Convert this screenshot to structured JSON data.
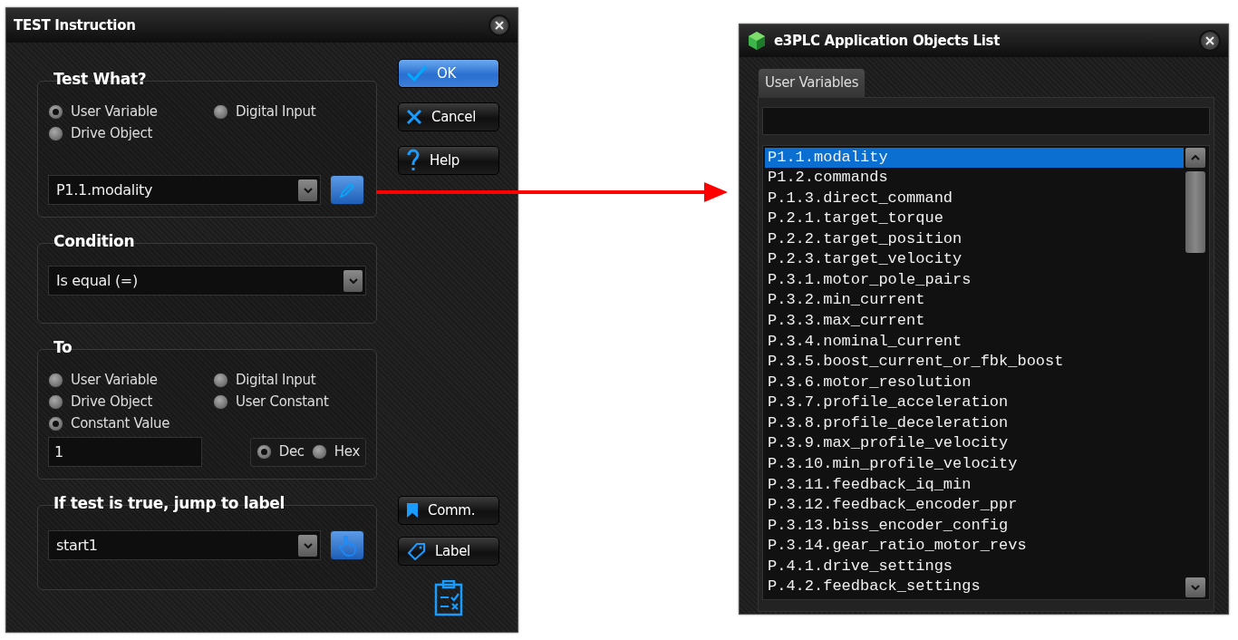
{
  "test_dialog": {
    "title": "TEST Instruction",
    "test_what": {
      "heading": "Test What?",
      "options": [
        {
          "label": "User Variable",
          "selected": true
        },
        {
          "label": "Digital Input",
          "selected": false
        },
        {
          "label": "Drive Object",
          "selected": false
        }
      ],
      "value": "P1.1.modality"
    },
    "condition": {
      "heading": "Condition",
      "value": "Is equal (=)"
    },
    "to": {
      "heading": "To",
      "options": [
        {
          "label": "User Variable",
          "selected": false
        },
        {
          "label": "Digital Input",
          "selected": false
        },
        {
          "label": "Drive Object",
          "selected": false
        },
        {
          "label": "User Constant",
          "selected": false
        },
        {
          "label": "Constant Value",
          "selected": true
        }
      ],
      "value": "1",
      "base": [
        {
          "label": "Dec",
          "selected": true
        },
        {
          "label": "Hex",
          "selected": false
        }
      ]
    },
    "jump": {
      "heading": "If test is true, jump to label",
      "value": "start1"
    },
    "buttons": [
      {
        "label": "OK",
        "kind": "ok"
      },
      {
        "label": "Cancel",
        "kind": "cancel"
      },
      {
        "label": "Help",
        "kind": "help"
      }
    ],
    "lower_buttons": [
      {
        "label": "Comm.",
        "kind": "comment"
      },
      {
        "label": "Label",
        "kind": "label"
      }
    ]
  },
  "objects_dialog": {
    "title": "e3PLC Application Objects List",
    "tabs": [
      {
        "label": "User Variables",
        "selected": true
      }
    ],
    "items": [
      {
        "label": "P1.1.modality",
        "selected": true
      },
      {
        "label": "P1.2.commands",
        "selected": false
      },
      {
        "label": "P.1.3.direct_command",
        "selected": false
      },
      {
        "label": "P.2.1.target_torque",
        "selected": false
      },
      {
        "label": "P.2.2.target_position",
        "selected": false
      },
      {
        "label": "P.2.3.target_velocity",
        "selected": false
      },
      {
        "label": "P.3.1.motor_pole_pairs",
        "selected": false
      },
      {
        "label": "P.3.2.min_current",
        "selected": false
      },
      {
        "label": "P.3.3.max_current",
        "selected": false
      },
      {
        "label": "P.3.4.nominal_current",
        "selected": false
      },
      {
        "label": "P.3.5.boost_current_or_fbk_boost",
        "selected": false
      },
      {
        "label": "P.3.6.motor_resolution",
        "selected": false
      },
      {
        "label": "P.3.7.profile_acceleration",
        "selected": false
      },
      {
        "label": "P.3.8.profile_deceleration",
        "selected": false
      },
      {
        "label": "P.3.9.max_profile_velocity",
        "selected": false
      },
      {
        "label": "P.3.10.min_profile_velocity",
        "selected": false
      },
      {
        "label": "P.3.11.feedback_iq_min",
        "selected": false
      },
      {
        "label": "P.3.12.feedback_encoder_ppr",
        "selected": false
      },
      {
        "label": "P.3.13.biss_encoder_config",
        "selected": false
      },
      {
        "label": "P.3.14.gear_ratio_motor_revs",
        "selected": false
      },
      {
        "label": "P.4.1.drive_settings",
        "selected": false
      },
      {
        "label": "P.4.2.feedback_settings",
        "selected": false
      }
    ]
  }
}
